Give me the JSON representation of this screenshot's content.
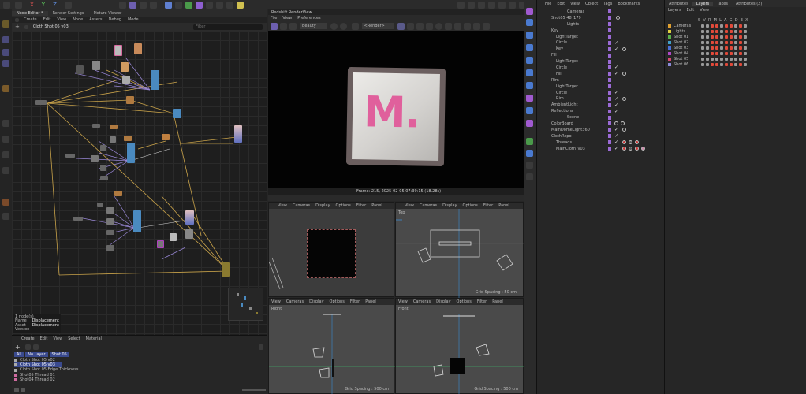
{
  "node_editor": {
    "tabs": [
      "Node Editor *",
      "Render Settings",
      "Picture Viewer"
    ],
    "menu": [
      "Create",
      "Edit",
      "View",
      "Node",
      "Assets",
      "Debug",
      "Mode"
    ],
    "path": "Cloth Shot 05 v03",
    "filter_placeholder": "Filter",
    "info": [
      {
        "k": "1 node(s)",
        "v": ""
      },
      {
        "k": "Name",
        "v": "Displacement"
      },
      {
        "k": "Asset",
        "v": "Displacement"
      },
      {
        "k": "Version",
        "v": ""
      }
    ]
  },
  "asset_panel": {
    "menu": [
      "Create",
      "Edit",
      "View",
      "Select",
      "Material"
    ],
    "filters": [
      "All",
      "No Layer",
      "Shot 05"
    ],
    "items": [
      "Cloth Shot 05 v02",
      "Cloth Shot 05 v03",
      "Cloth Shot 05 Edge Thickness",
      "Shot05 Thread 01",
      "Shot04 Thread 02"
    ]
  },
  "render_view": {
    "title": "Redshift RenderView",
    "menu": [
      "File",
      "View",
      "Preferences"
    ],
    "beauty_select": "Beauty",
    "render_select": "<Render>",
    "logo_text": "M.",
    "status": "Frame: 215,  2025-02-05  07:39:15  (18.28s)"
  },
  "viewports": [
    {
      "menu": [
        "View",
        "Cameras",
        "Display",
        "Options",
        "Filter",
        "Panel"
      ],
      "label": "",
      "grid": ""
    },
    {
      "menu": [
        "View",
        "Cameras",
        "Display",
        "Options",
        "Filter",
        "Panel"
      ],
      "label": "Top",
      "grid": "Grid Spacing : 50 cm"
    },
    {
      "menu": [
        "View",
        "Cameras",
        "Display",
        "Options",
        "Filter",
        "Panel"
      ],
      "label": "Right",
      "grid": "Grid Spacing : 500 cm"
    },
    {
      "menu": [
        "View",
        "Cameras",
        "Display",
        "Options",
        "Filter",
        "Panel"
      ],
      "label": "Front",
      "grid": "Grid Spacing : 500 cm"
    }
  ],
  "object_manager": {
    "menu": [
      "File",
      "Edit",
      "View",
      "Object",
      "Tags",
      "Bookmarks"
    ],
    "rows": [
      {
        "name": "Cameras",
        "indent": 0
      },
      {
        "name": "Shot05 48_179",
        "indent": 1
      },
      {
        "name": "Lights",
        "indent": 0
      },
      {
        "name": "Key",
        "indent": 1
      },
      {
        "name": "LightTarget",
        "indent": 2
      },
      {
        "name": "Circle",
        "indent": 2
      },
      {
        "name": "Key",
        "indent": 2
      },
      {
        "name": "Fill",
        "indent": 1
      },
      {
        "name": "LightTarget",
        "indent": 2
      },
      {
        "name": "Circle",
        "indent": 2
      },
      {
        "name": "Fill",
        "indent": 2
      },
      {
        "name": "Rim",
        "indent": 1
      },
      {
        "name": "LightTarget",
        "indent": 2
      },
      {
        "name": "Circle",
        "indent": 2
      },
      {
        "name": "Rim",
        "indent": 2
      },
      {
        "name": "AmbientLight",
        "indent": 1
      },
      {
        "name": "Reflections",
        "indent": 1
      },
      {
        "name": "Scene",
        "indent": 0
      },
      {
        "name": "ColorBoard",
        "indent": 1
      },
      {
        "name": "MainDomeLight360",
        "indent": 1
      },
      {
        "name": "ClothRepo",
        "indent": 1
      },
      {
        "name": "Threads",
        "indent": 2
      },
      {
        "name": "MainCloth_v03",
        "indent": 2
      }
    ]
  },
  "attributes": {
    "tabs": [
      "Attributes",
      "Layers",
      "Takes",
      "Attributes (2)"
    ],
    "menu": [
      "Layers",
      "Edit",
      "View"
    ],
    "columns": "S  V  R  M  L  A  G  D  E  X",
    "layers": [
      {
        "name": "Cameras",
        "color": "#e0a030"
      },
      {
        "name": "Lights",
        "color": "#e0d040"
      },
      {
        "name": "Shot 01",
        "color": "#5ab04a"
      },
      {
        "name": "Shot 02",
        "color": "#40a0c8"
      },
      {
        "name": "Shot 03",
        "color": "#4a70d8"
      },
      {
        "name": "Shot 04",
        "color": "#b048c8"
      },
      {
        "name": "Shot 05",
        "color": "#d84870"
      },
      {
        "name": "Shot 06",
        "color": "#8a8ad8"
      }
    ]
  },
  "colors": {
    "accent": "#9b6ad6",
    "selection": "#3a4a6e",
    "toolbar_bg": "#262626"
  }
}
